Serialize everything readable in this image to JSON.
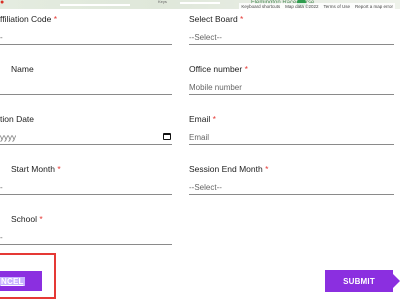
{
  "map": {
    "place_label": "Flemington Racecourse",
    "road_label": "Keys",
    "attribution": [
      "Keyboard shortcuts",
      "Map data ©2022",
      "Terms of Use",
      "Report a map error"
    ]
  },
  "form": {
    "left": [
      {
        "label": "ffiliation Code",
        "required": true,
        "value": "-"
      },
      {
        "label": "Name",
        "required": false,
        "value": ""
      },
      {
        "label": "tion Date",
        "required": false,
        "value": "yyyy"
      },
      {
        "label": "Start Month",
        "required": true,
        "value": "-"
      },
      {
        "label": "School",
        "required": true,
        "value": "-"
      }
    ],
    "right": [
      {
        "label": "Select Board",
        "required": true,
        "value": "--Select--"
      },
      {
        "label": "Office number",
        "required": true,
        "placeholder": "Mobile number"
      },
      {
        "label": "Email",
        "required": true,
        "placeholder": "Email"
      },
      {
        "label": "Session End Month",
        "required": true,
        "value": "--Select--"
      }
    ],
    "required_mark": "*"
  },
  "buttons": {
    "cancel": "NCEL",
    "submit": "SUBMIT"
  },
  "colors": {
    "accent": "#8b2fe0",
    "required": "#e53935",
    "highlight_outline": "#e53935"
  }
}
